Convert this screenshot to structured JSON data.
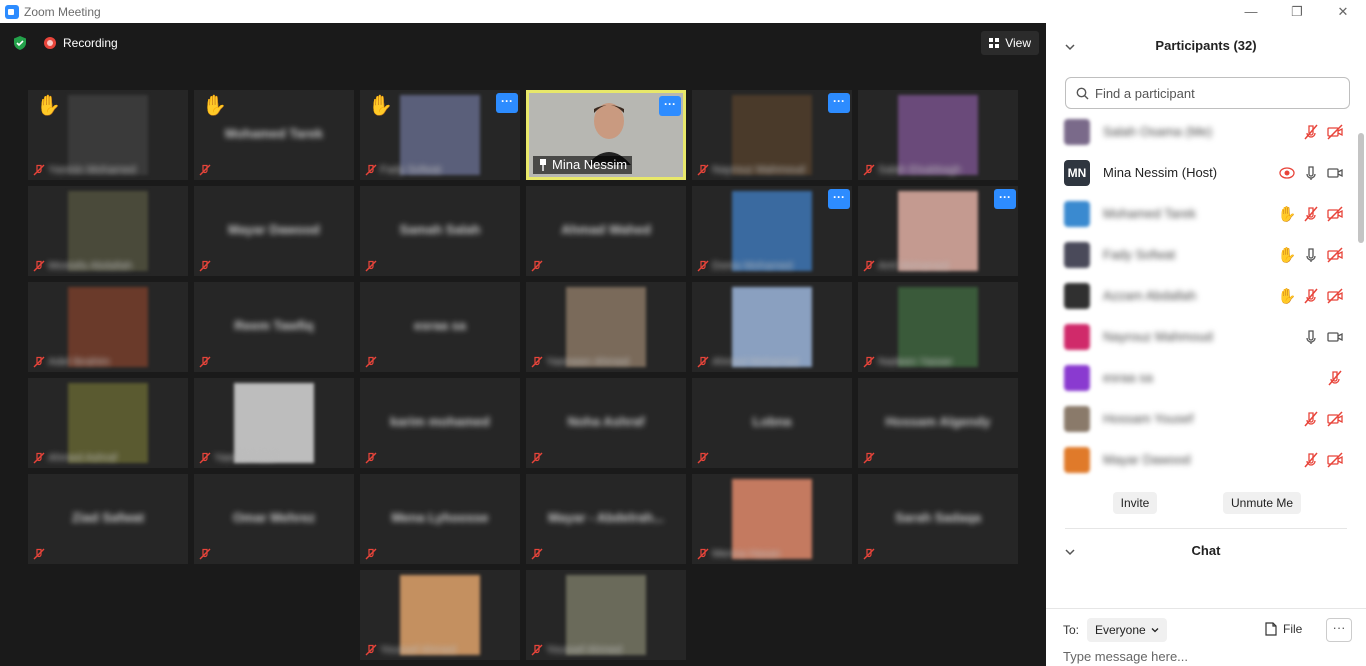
{
  "window": {
    "title": "Zoom Meeting",
    "minimize_icon": "—",
    "restore_icon": "❐",
    "close_icon": "✕"
  },
  "topbar": {
    "recording_label": "Recording",
    "view_label": "View"
  },
  "colors": {
    "accent": "#2d8cff",
    "active_border": "#e8e86a",
    "muted_red": "#e8443a",
    "hand": "#f6c12a"
  },
  "tiles": [
    {
      "name": "",
      "label": "Yasmin Mohamed",
      "hand": true,
      "more": false,
      "photo": "#3a3a3a"
    },
    {
      "name": "Mohamed Tarek",
      "label": "",
      "hand": true,
      "more": false,
      "photo": ""
    },
    {
      "name": "",
      "label": "Fady Sofwat",
      "hand": true,
      "more": true,
      "photo": "#5a5f7a"
    },
    {
      "name": "Mina Nessim",
      "label": "",
      "hand": false,
      "more": true,
      "photo": "",
      "active": true
    },
    {
      "name": "",
      "label": "Nayrouz Mahmoud",
      "hand": false,
      "more": true,
      "photo": "#4a3a2a"
    },
    {
      "name": "",
      "label": "Salah Elsabbagh",
      "hand": false,
      "more": false,
      "photo": "#6a4a7a"
    },
    {
      "name": "",
      "label": "Mostafa Abdallah",
      "hand": false,
      "more": false,
      "photo": "#4a4a3a"
    },
    {
      "name": "Mayar Dawood",
      "label": "",
      "hand": false,
      "more": false,
      "photo": ""
    },
    {
      "name": "Samah Salah",
      "label": "",
      "hand": false,
      "more": false,
      "photo": ""
    },
    {
      "name": "Ahmad Wahed",
      "label": "",
      "hand": false,
      "more": false,
      "photo": ""
    },
    {
      "name": "",
      "label": "Donia Mohamed",
      "hand": false,
      "more": true,
      "photo": "#3a6aa0"
    },
    {
      "name": "",
      "label": "Aml Mohamed",
      "hand": false,
      "more": true,
      "photo": "#c49a90"
    },
    {
      "name": "",
      "label": "Adel Ibrahim",
      "hand": false,
      "more": false,
      "photo": "#6a3a2a"
    },
    {
      "name": "Reem Tawfiq",
      "label": "",
      "hand": false,
      "more": false,
      "photo": ""
    },
    {
      "name": "esraa sa",
      "label": "",
      "hand": false,
      "more": false,
      "photo": ""
    },
    {
      "name": "",
      "label": "Yasmeen Ahmed",
      "hand": false,
      "more": false,
      "photo": "#7a6a5a"
    },
    {
      "name": "",
      "label": "Ahmed Mohamed",
      "hand": false,
      "more": false,
      "photo": "#8aa0c0"
    },
    {
      "name": "",
      "label": "Nadeen Yasser",
      "hand": false,
      "more": false,
      "photo": "#3a5a3a"
    },
    {
      "name": "",
      "label": "Ahmed Ashraf",
      "hand": false,
      "more": false,
      "photo": "#5a5a30"
    },
    {
      "name": "",
      "label": "Yasmin Adel",
      "hand": false,
      "more": false,
      "photo": "#bdbdbd"
    },
    {
      "name": "karim mohamed",
      "label": "",
      "hand": false,
      "more": false,
      "photo": ""
    },
    {
      "name": "Noha Ashraf",
      "label": "",
      "hand": false,
      "more": false,
      "photo": ""
    },
    {
      "name": "Lobna",
      "label": "",
      "hand": false,
      "more": false,
      "photo": ""
    },
    {
      "name": "Hossam Algendy",
      "label": "",
      "hand": false,
      "more": false,
      "photo": ""
    },
    {
      "name": "Ziad Safwat",
      "label": "",
      "hand": false,
      "more": false,
      "photo": ""
    },
    {
      "name": "Omar Mehrez",
      "label": "",
      "hand": false,
      "more": false,
      "photo": ""
    },
    {
      "name": "Mena Lyhoosse",
      "label": "",
      "hand": false,
      "more": false,
      "photo": ""
    },
    {
      "name": "Mayar - Abdelrah...",
      "label": "",
      "hand": false,
      "more": false,
      "photo": ""
    },
    {
      "name": "",
      "label": "Menna Hasan",
      "hand": false,
      "more": false,
      "photo": "#c47a60"
    },
    {
      "name": "Sarah Sadaqa",
      "label": "",
      "hand": false,
      "more": false,
      "photo": ""
    },
    {
      "name": "",
      "label": "Youssef Ahmed",
      "hand": false,
      "more": false,
      "photo": "#c49060"
    },
    {
      "name": "",
      "label": "Youssef Ahmed",
      "hand": false,
      "more": false,
      "photo": "#6a6a5a"
    }
  ],
  "participants": {
    "title": "Participants (32)",
    "search_placeholder": "Find a participant",
    "list": [
      {
        "name": "Salah Osama (Me)",
        "avatar": "#7a6a8a",
        "initials": "",
        "clear": false,
        "icons": [
          "mic-muted",
          "video-off"
        ]
      },
      {
        "name": "Mina Nessim (Host)",
        "avatar": "#2f3640",
        "initials": "MN",
        "clear": true,
        "icons": [
          "record",
          "mic",
          "video"
        ]
      },
      {
        "name": "Mohamed Tarek",
        "avatar": "#3a8ad0",
        "initials": "",
        "clear": false,
        "icons": [
          "hand",
          "mic-muted",
          "video-off"
        ]
      },
      {
        "name": "Fady Sofwat",
        "avatar": "#4a4a5a",
        "initials": "",
        "clear": false,
        "icons": [
          "hand",
          "mic",
          "video-off"
        ]
      },
      {
        "name": "Azzam Abdallah",
        "avatar": "#303030",
        "initials": "",
        "clear": false,
        "icons": [
          "hand",
          "mic-muted",
          "video-off"
        ]
      },
      {
        "name": "Nayrouz Mahmoud",
        "avatar": "#d02a6a",
        "initials": "",
        "clear": false,
        "icons": [
          "mic",
          "video"
        ]
      },
      {
        "name": "esraa sa",
        "avatar": "#8a3ad0",
        "initials": "",
        "clear": false,
        "icons": [
          "mic-muted"
        ]
      },
      {
        "name": "Hossam Yousef",
        "avatar": "#8a7a6a",
        "initials": "",
        "clear": false,
        "icons": [
          "mic-muted",
          "video-off"
        ]
      },
      {
        "name": "Mayar Dawood",
        "avatar": "#e07a2a",
        "initials": "",
        "clear": false,
        "icons": [
          "mic-muted",
          "video-off"
        ]
      }
    ],
    "invite_label": "Invite",
    "unmute_label": "Unmute Me"
  },
  "chat": {
    "title": "Chat",
    "to_label": "To:",
    "to_value": "Everyone",
    "file_label": "File",
    "more_label": "···",
    "message_placeholder": "Type message here..."
  }
}
